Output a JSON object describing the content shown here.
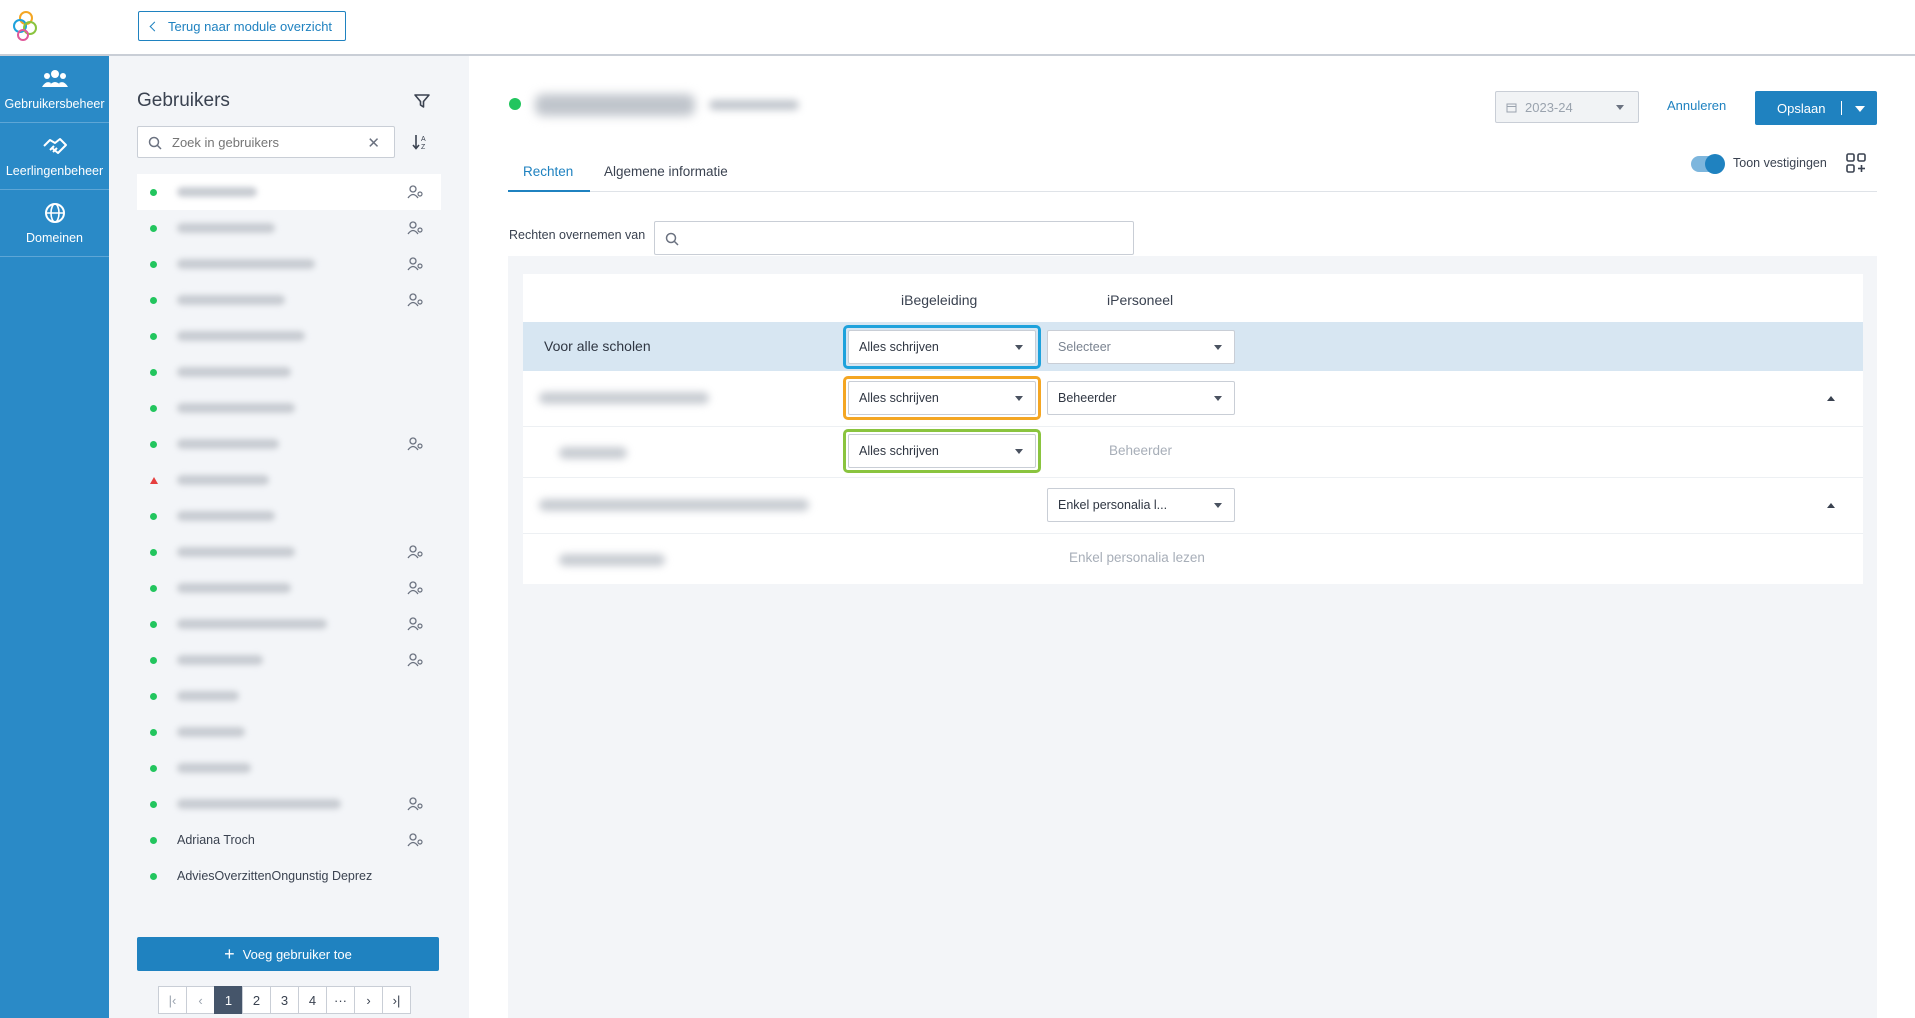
{
  "topbar": {
    "back_label": "Terug naar module overzicht"
  },
  "nav": {
    "items": [
      {
        "label": "Gebruikersbeheer",
        "icon": "users-icon"
      },
      {
        "label": "Leerlingenbeheer",
        "icon": "handshake-icon"
      },
      {
        "label": "Domeinen",
        "icon": "globe-icon"
      }
    ]
  },
  "users": {
    "title": "Gebruikers",
    "search_placeholder": "Zoek in gebruikers",
    "named": [
      "Adriana Troch",
      "AdviesOverzittenOngunstig Deprez"
    ],
    "add_label": "Voeg gebruiker toe",
    "pages": [
      "1",
      "2",
      "3",
      "4",
      "···"
    ],
    "current_page": "1"
  },
  "main": {
    "year": "2023-24",
    "cancel_label": "Annuleren",
    "save_label": "Opslaan",
    "tabs": [
      "Rechten",
      "Algemene informatie"
    ],
    "toggle_label": "Toon vestigingen",
    "toggle_on": true,
    "copy_label": "Rechten overnemen van",
    "columns": [
      "iBegeleiding",
      "iPersoneel"
    ],
    "rows": {
      "all_schools": {
        "label": "Voor alle scholen",
        "ibegeleiding": "Alles schrijven",
        "ipersoneel": "Selecteer"
      },
      "school1": {
        "ibegeleiding": "Alles schrijven",
        "ipersoneel": "Beheerder"
      },
      "school1_sub": {
        "ibegeleiding": "Alles schrijven",
        "ipersoneel": "Beheerder"
      },
      "school2": {
        "ipersoneel": "Enkel personalia l..."
      },
      "school2_sub": {
        "ipersoneel": "Enkel personalia lezen"
      }
    }
  },
  "colors": {
    "primary": "#1f82c0",
    "nav_bg": "#2a8ac7",
    "status_active": "#22c55e",
    "status_warning": "#e53e3e",
    "highlight_row": "#d7e6f2",
    "ring_blue": "#1ea2dc",
    "ring_orange": "#f4a623",
    "ring_green": "#8ac43f"
  }
}
